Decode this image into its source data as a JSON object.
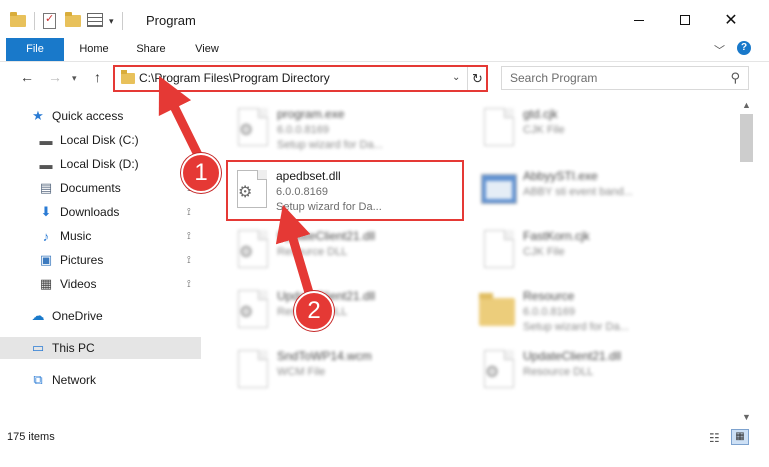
{
  "window": {
    "title": "Program",
    "minimize_icon": "minimize-icon",
    "maximize_icon": "maximize-icon",
    "close_icon": "close-icon",
    "close_glyph": "✕"
  },
  "ribbon": {
    "tabs": [
      {
        "label": "File"
      },
      {
        "label": "Home"
      },
      {
        "label": "Share"
      },
      {
        "label": "View"
      }
    ],
    "expand_glyph": "﹀",
    "help_glyph": "?"
  },
  "navigation": {
    "back_glyph": "←",
    "forward_glyph": "→",
    "recent_glyph": "▾",
    "up_glyph": "↑",
    "address": "C:\\Program Files\\Program Directory",
    "address_dropdown_glyph": "⌄",
    "refresh_glyph": "↻",
    "search_placeholder": "Search Program",
    "search_glyph": "⚲"
  },
  "sidebar": {
    "items": [
      {
        "label": "Quick access",
        "icon": "star-icon",
        "glyph": "★",
        "pinned": false
      },
      {
        "label": "Local Disk (C:)",
        "icon": "drive-icon",
        "glyph": "▬",
        "pinned": true
      },
      {
        "label": "Local Disk (D:)",
        "icon": "drive-icon",
        "glyph": "▬",
        "pinned": true
      },
      {
        "label": "Documents",
        "icon": "documents-icon",
        "glyph": "▤",
        "pinned": true
      },
      {
        "label": "Downloads",
        "icon": "download-icon",
        "glyph": "⬇",
        "pinned": true
      },
      {
        "label": "Music",
        "icon": "music-icon",
        "glyph": "♪",
        "pinned": true
      },
      {
        "label": "Pictures",
        "icon": "pictures-icon",
        "glyph": "▣",
        "pinned": true
      },
      {
        "label": "Videos",
        "icon": "videos-icon",
        "glyph": "▦",
        "pinned": true
      },
      {
        "label": "OneDrive",
        "icon": "cloud-icon",
        "glyph": "☁",
        "pinned": false
      },
      {
        "label": "This PC",
        "icon": "computer-icon",
        "glyph": "▭",
        "pinned": false,
        "selected": true
      },
      {
        "label": "Network",
        "icon": "network-icon",
        "glyph": "⧉",
        "pinned": false
      }
    ],
    "pin_glyph": "📌"
  },
  "files": [
    {
      "name": "program.exe",
      "line2": "6.0.0.8169",
      "line3": "Setup wizard for Da...",
      "kind": "exe",
      "blurred": true
    },
    {
      "name": "gtd.cjk",
      "line2": "CJK File",
      "line3": "",
      "kind": "doc",
      "blurred": true
    },
    {
      "name": "apedbset.dll",
      "line2": "6.0.0.8169",
      "line3": "Setup wizard for Da...",
      "kind": "dll",
      "blurred": false,
      "highlighted": true
    },
    {
      "name": "AbbyySTI.exe",
      "line2": "ABBY sti event band...",
      "line3": "",
      "kind": "window",
      "blurred": true
    },
    {
      "name": "UpdateClient21.dll",
      "line2": "Resource DLL",
      "line3": "",
      "kind": "dll",
      "blurred": true
    },
    {
      "name": "FastKorn.cjk",
      "line2": "CJK File",
      "line3": "",
      "kind": "doc",
      "blurred": true
    },
    {
      "name": "UpdateClient21.dll",
      "line2": "Resource DLL",
      "line3": "",
      "kind": "dll",
      "blurred": true
    },
    {
      "name": "Resource",
      "line2": "6.0.0.8169",
      "line3": "Setup wizard for Da...",
      "kind": "folder",
      "blurred": true
    },
    {
      "name": "SndToWP14.wcm",
      "line2": "WCM File",
      "line3": "",
      "kind": "doc",
      "blurred": true
    },
    {
      "name": "UpdateClient21.dll",
      "line2": "Resource DLL",
      "line3": "",
      "kind": "dll",
      "blurred": true
    }
  ],
  "scrollbar": {
    "up_glyph": "▲",
    "down_glyph": "▼"
  },
  "status": {
    "item_count": "175 items",
    "details_view_glyph": "☷",
    "tiles_view_glyph": "▦"
  },
  "annotations": {
    "step1": "1",
    "step2": "2",
    "color": "#e53935"
  },
  "colors": {
    "accent": "#1979ca",
    "annotation": "#e53935",
    "selection": "#e5e5e5"
  }
}
